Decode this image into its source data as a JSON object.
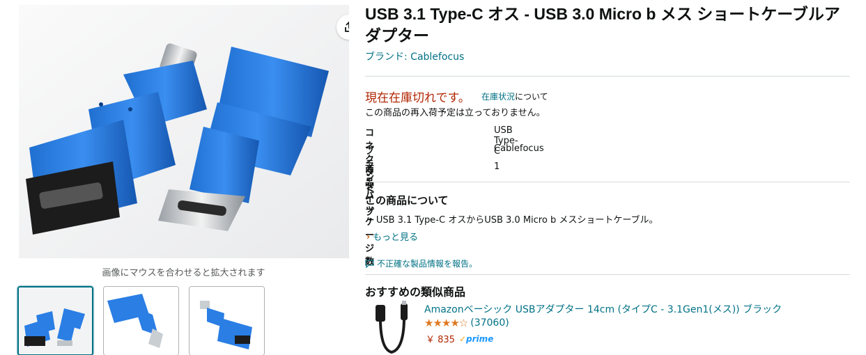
{
  "product": {
    "title": "USB 3.1 Type-C オス - USB 3.0 Micro b メス ショートケーブルアダプター",
    "brand_link": "ブランド: Cablefocus"
  },
  "gallery": {
    "hover_hint": "画像にマウスを合わせると拡大されます",
    "share_icon": "share-icon",
    "thumbnail_count": 3,
    "selected_index": 0
  },
  "availability": {
    "status": "現在在庫切れです。",
    "info_link": "在庫状況",
    "info_suffix": "について",
    "restock_note": "この商品の再入荷予定は立っておりません。"
  },
  "specs": [
    {
      "key": "コネクタタイプ",
      "value": "USB Type-C"
    },
    {
      "key": "ブランド",
      "value": "Cablefocus"
    },
    {
      "key": "商品パッケージ数",
      "value": "1"
    }
  ],
  "about": {
    "heading": "この商品について",
    "bullets": [
      "USB 3.1 Type-C オスからUSB 3.0 Micro b メスショートケーブル。"
    ],
    "see_more": "もっと見る",
    "report": "不正確な製品情報を報告。"
  },
  "recommendations": {
    "heading": "おすすめの類似商品",
    "items": [
      {
        "title": "Amazonベーシック USBアダプター 14cm (タイプC - 3.1Gen1(メス)) ブラック",
        "stars": "★★★★☆",
        "rating_value": 4.5,
        "review_count": "(37060)",
        "price": "￥ 835",
        "prime": "prime"
      }
    ]
  },
  "colors": {
    "link": "#007185",
    "price": "#b12704",
    "star": "#de7921",
    "adapter_blue": "#1a6fd6",
    "selected_border": "#007185"
  }
}
